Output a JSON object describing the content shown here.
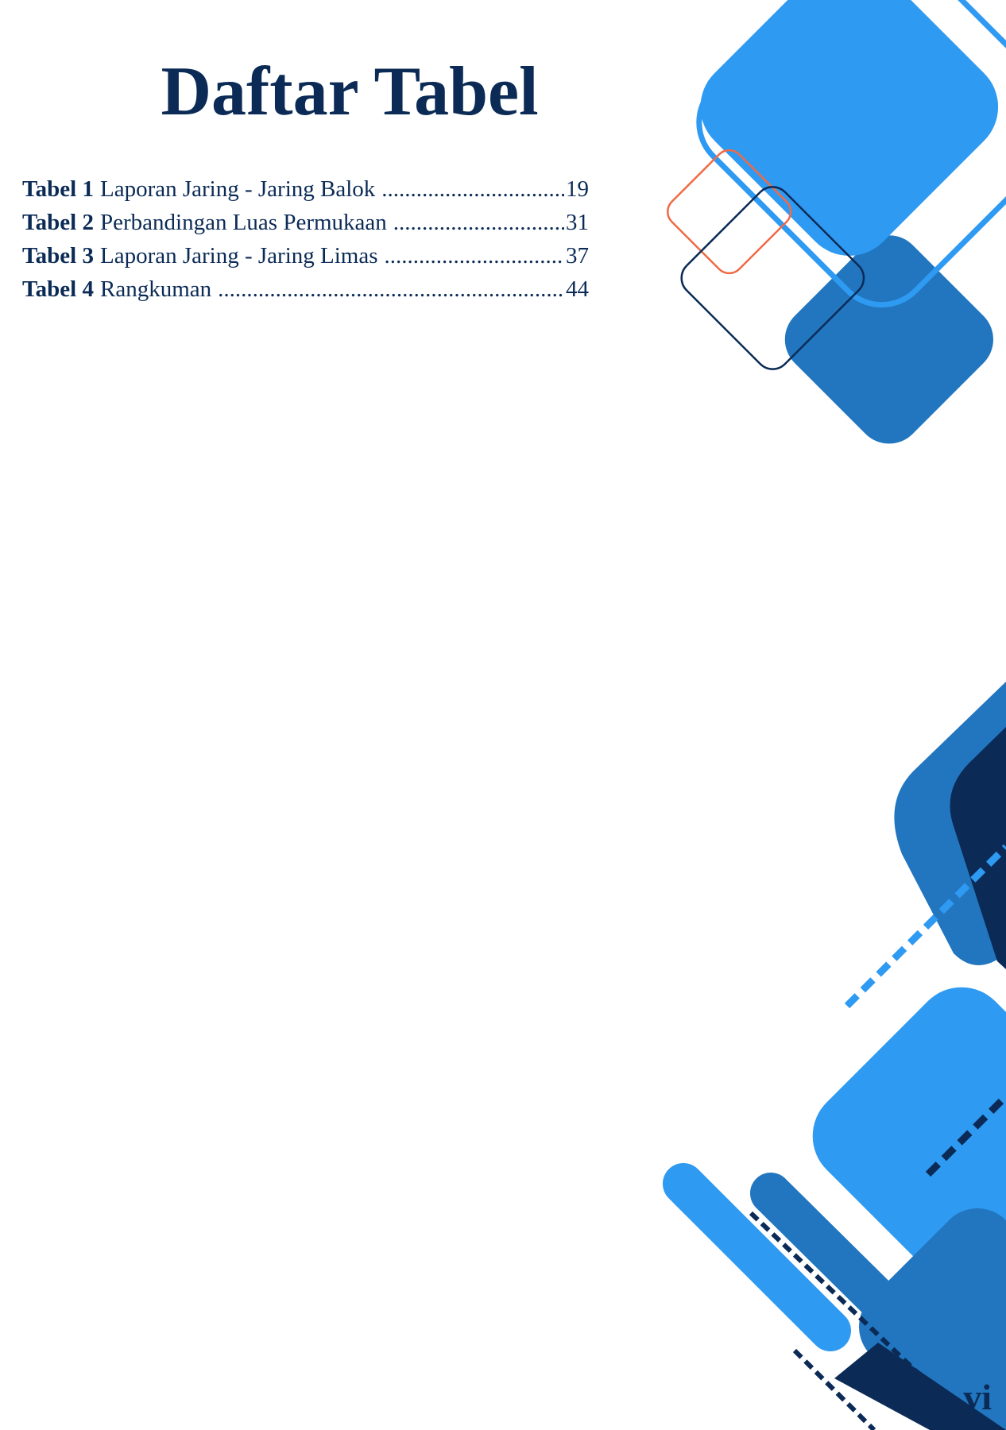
{
  "title": "Daftar Tabel",
  "toc": [
    {
      "label": "Tabel  1",
      "title": "Laporan Jaring - Jaring Balok",
      "page": "19"
    },
    {
      "label": "Tabel 2",
      "title": "Perbandingan Luas Permukaan",
      "page": "31"
    },
    {
      "label": "Tabel 3",
      "title": "Laporan Jaring - Jaring Limas",
      "page": "37"
    },
    {
      "label": "Tabel 4",
      "title": "Rangkuman",
      "page": "44"
    }
  ],
  "page_number": "vi",
  "colors": {
    "navy": "#0b2b56",
    "blue_light": "#2f9af2",
    "blue_mid": "#2176bf",
    "orange": "#ef6a45"
  }
}
